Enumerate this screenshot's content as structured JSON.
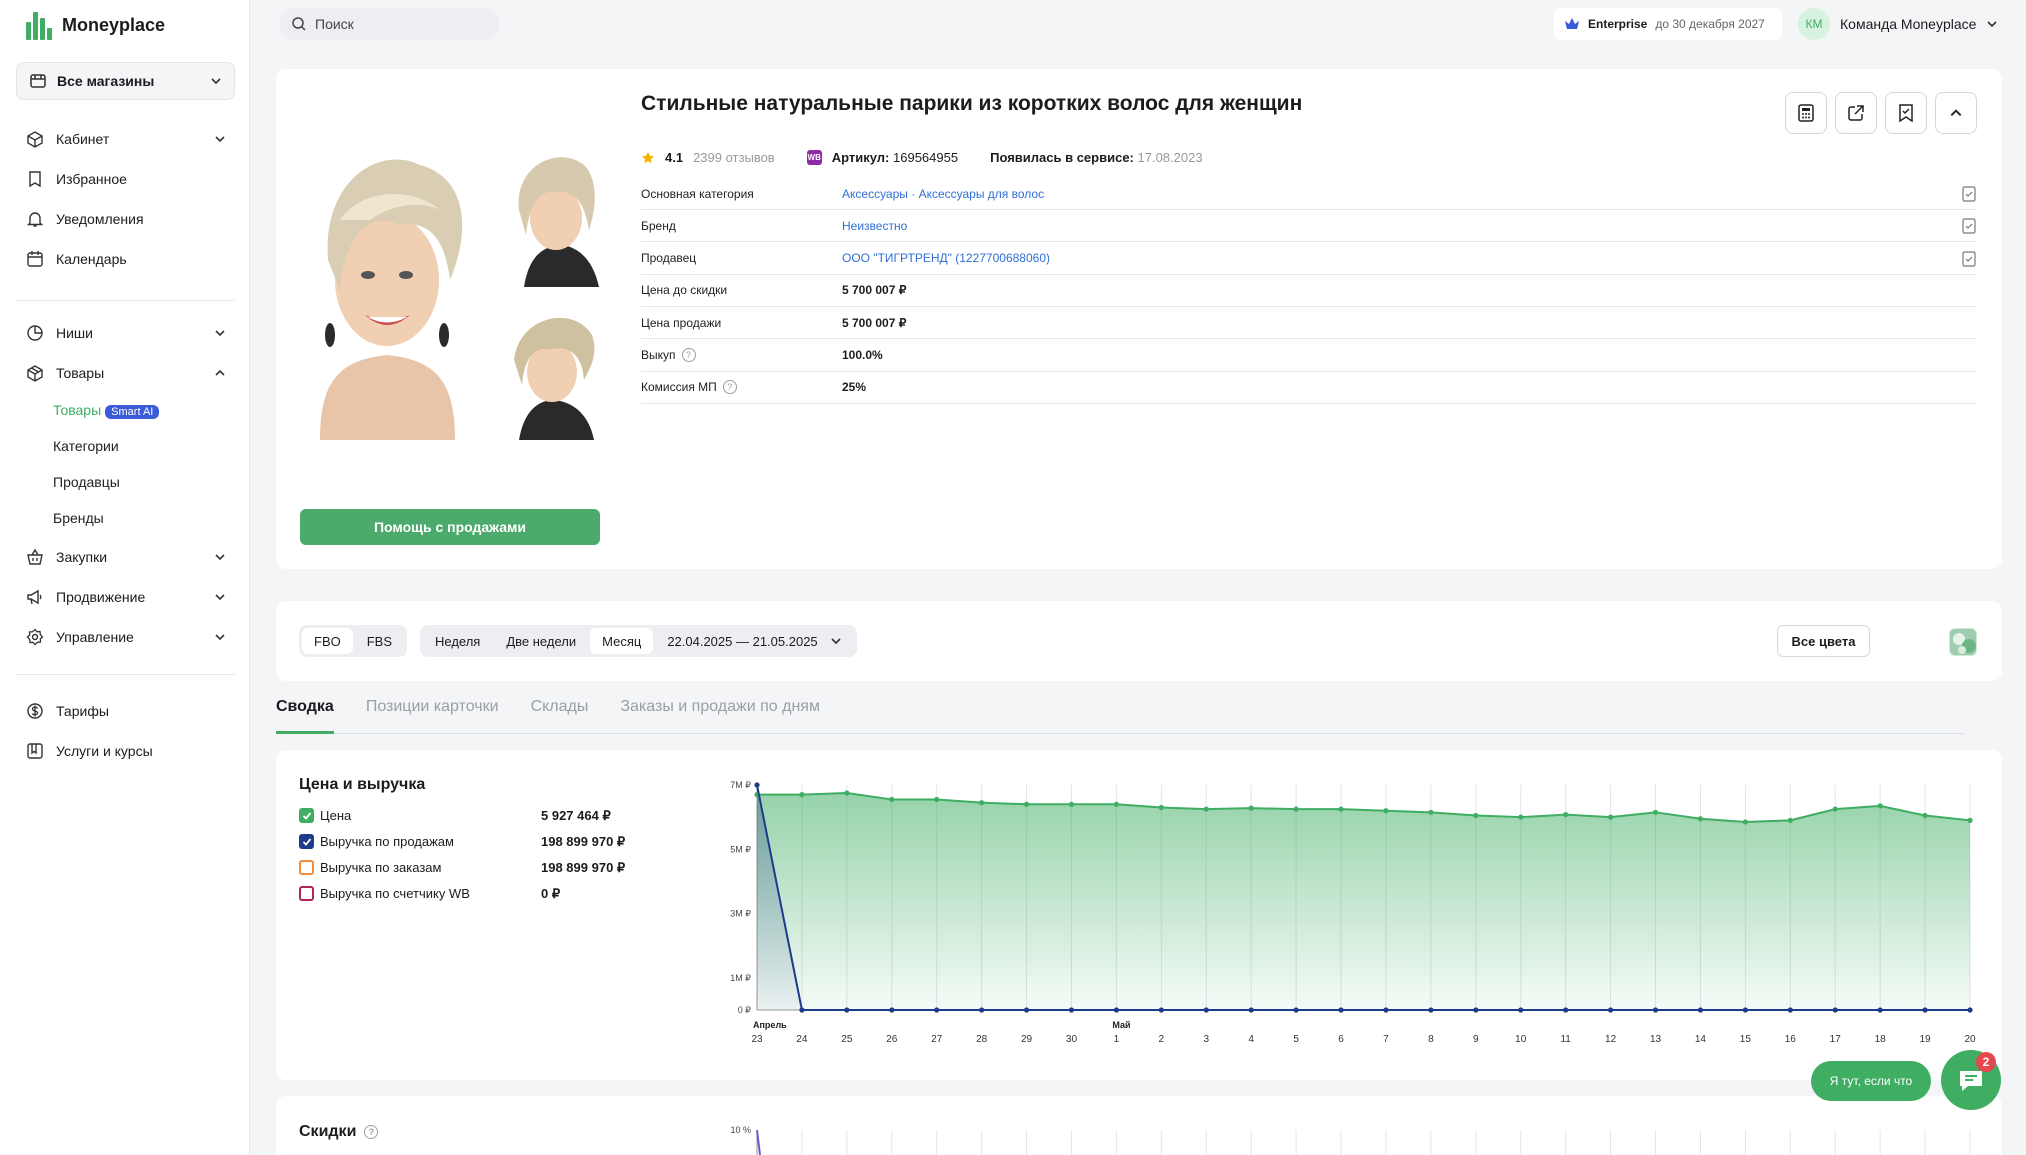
{
  "brand": {
    "name": "Moneyplace",
    "accent": "#3fae63"
  },
  "sidebar": {
    "store_selector": "Все магазины",
    "group1": [
      {
        "label": "Кабинет",
        "icon": "cube-icon",
        "chevron": true
      },
      {
        "label": "Избранное",
        "icon": "bookmark-icon",
        "chevron": false
      },
      {
        "label": "Уведомления",
        "icon": "bell-icon",
        "chevron": false
      },
      {
        "label": "Календарь",
        "icon": "calendar-icon",
        "chevron": false
      }
    ],
    "group2": [
      {
        "label": "Ниши",
        "icon": "pie-chart-icon",
        "chevron": true
      },
      {
        "label": "Товары",
        "icon": "box-icon",
        "chevron": true
      }
    ],
    "goods_sub": {
      "active": "Товары",
      "badge": "Smart AI",
      "items": [
        "Категории",
        "Продавцы",
        "Бренды"
      ]
    },
    "group3": [
      {
        "label": "Закупки",
        "icon": "basket-icon",
        "chevron": true
      },
      {
        "label": "Продвижение",
        "icon": "megaphone-icon",
        "chevron": true
      },
      {
        "label": "Управление",
        "icon": "settings-icon",
        "chevron": true
      }
    ],
    "group4": [
      {
        "label": "Тарифы",
        "icon": "dollar-icon"
      },
      {
        "label": "Услуги и курсы",
        "icon": "courses-icon"
      }
    ]
  },
  "topbar": {
    "search_placeholder": "Поиск",
    "plan": "Enterprise",
    "plan_until": "до 30 декабря 2027",
    "avatar_initials": "КМ",
    "team": "Команда Moneyplace"
  },
  "product": {
    "title": "Стильные натуральные парики из коротких волос для женщин",
    "rating": "4.1",
    "reviews": "2399 отзывов",
    "article_label": "Артикул:",
    "article": "169564955",
    "wb_badge": "WB",
    "appeared_label": "Появилась в сервисе:",
    "appeared": "17.08.2023",
    "help_button": "Помощь с продажами",
    "props": [
      {
        "label": "Основная категория",
        "value": "Аксессуары · Аксессуары для волос",
        "link": true,
        "bookmark": true,
        "help": false
      },
      {
        "label": "Бренд",
        "value": "Неизвестно",
        "link": true,
        "bookmark": true,
        "help": false
      },
      {
        "label": "Продавец",
        "value": "ООО \"ТИГРТРЕНД\" (1227700688060)",
        "link": true,
        "bookmark": true,
        "help": false
      },
      {
        "label": "Цена до скидки",
        "value": "5 700 007 ₽",
        "link": false,
        "bookmark": false,
        "help": false
      },
      {
        "label": "Цена продажи",
        "value": "5 700 007 ₽",
        "link": false,
        "bookmark": false,
        "help": false
      },
      {
        "label": "Выкуп",
        "value": "100.0%",
        "link": false,
        "bookmark": false,
        "help": true
      },
      {
        "label": "Комиссия МП",
        "value": "25%",
        "link": false,
        "bookmark": false,
        "help": true
      }
    ]
  },
  "filters": {
    "fulfillment": [
      "FBO",
      "FBS"
    ],
    "periods": [
      "Неделя",
      "Две недели",
      "Месяц"
    ],
    "active_period": "Месяц",
    "date_range": "22.04.2025 — 21.05.2025",
    "all_colors": "Все цвета"
  },
  "tabs": [
    "Сводка",
    "Позиции карточки",
    "Склады",
    "Заказы и продажи по дням"
  ],
  "active_tab": "Сводка",
  "summary": {
    "title": "Цена и выручка",
    "legend": [
      {
        "label": "Цена",
        "value": "5 927 464 ₽",
        "color": "#3fae63",
        "checked": true
      },
      {
        "label": "Выручка по продажам",
        "value": "198 899 970 ₽",
        "color": "#1e3a8a",
        "checked": true
      },
      {
        "label": "Выручка по заказам",
        "value": "198 899 970 ₽",
        "color": "#f08c3b",
        "checked": false
      },
      {
        "label": "Выручка по счетчику WB",
        "value": "0 ₽",
        "color": "#b0245c",
        "checked": false
      }
    ]
  },
  "discounts": {
    "title": "Скидки",
    "y_top": "10 %"
  },
  "chat": {
    "label": "Я тут, если что",
    "badge": "2"
  },
  "chart_data": {
    "type": "area",
    "y_ticks": [
      "0 ₽",
      "1M ₽",
      "3M ₽",
      "5M ₽",
      "7M ₽"
    ],
    "ylim": [
      0,
      7000000
    ],
    "month_labels": [
      {
        "at": "23",
        "label": "Апрель"
      },
      {
        "at": "1",
        "label": "Май"
      }
    ],
    "categories": [
      "23",
      "24",
      "25",
      "26",
      "27",
      "28",
      "29",
      "30",
      "1",
      "2",
      "3",
      "4",
      "5",
      "6",
      "7",
      "8",
      "9",
      "10",
      "11",
      "12",
      "13",
      "14",
      "15",
      "16",
      "17",
      "18",
      "19",
      "20"
    ],
    "series": [
      {
        "name": "Цена",
        "color": "#3fae63",
        "values": [
          6700000,
          6700000,
          6750000,
          6550000,
          6550000,
          6450000,
          6400000,
          6400000,
          6400000,
          6300000,
          6250000,
          6280000,
          6250000,
          6250000,
          6200000,
          6150000,
          6050000,
          6000000,
          6080000,
          6000000,
          6150000,
          5950000,
          5850000,
          5900000,
          6250000,
          6350000,
          6050000,
          5900000
        ]
      },
      {
        "name": "Выручка по продажам",
        "color": "#1e3a8a",
        "values": [
          7000000,
          0,
          0,
          0,
          0,
          0,
          0,
          0,
          0,
          0,
          0,
          0,
          0,
          0,
          0,
          0,
          0,
          0,
          0,
          0,
          0,
          0,
          0,
          0,
          0,
          0,
          0,
          0
        ]
      }
    ]
  }
}
